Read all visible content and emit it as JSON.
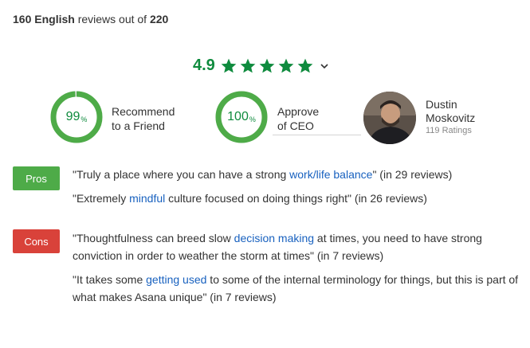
{
  "summary": {
    "count": "160 English",
    "middle": " reviews out of ",
    "total": "220"
  },
  "rating": {
    "value": "4.9",
    "stars": 5,
    "star_color": "#0f8b3e"
  },
  "metrics": {
    "recommend": {
      "percent": "99",
      "symbol": "%",
      "fraction": 0.99,
      "line1": "Recommend",
      "line2": "to a Friend"
    },
    "ceo_approve": {
      "percent": "100",
      "symbol": "%",
      "fraction": 1.0,
      "line1": "Approve",
      "line2": "of CEO"
    }
  },
  "ceo": {
    "name_line1": "Dustin",
    "name_line2": "Moskovitz",
    "ratings": "119 Ratings"
  },
  "pros": {
    "label": "Pros",
    "color": "#4eab48",
    "quotes": [
      {
        "pre": "\"Truly a place where you can have a strong ",
        "keyword": "work/life balance",
        "post": "\" (in 29 reviews)"
      },
      {
        "pre": "\"Extremely ",
        "keyword": "mindful",
        "post": " culture focused on doing things right\" (in 26 reviews)"
      }
    ]
  },
  "cons": {
    "label": "Cons",
    "color": "#d9423a",
    "quotes": [
      {
        "pre": "\"Thoughtfulness can breed slow ",
        "keyword": "decision making",
        "post": " at times, you need to have strong conviction in order to weather the storm at times\" (in 7 reviews)"
      },
      {
        "pre": "\"It takes some ",
        "keyword": "getting used",
        "post": " to some of the internal terminology for things, but this is part of what makes Asana unique\" (in 7 reviews)"
      }
    ]
  }
}
